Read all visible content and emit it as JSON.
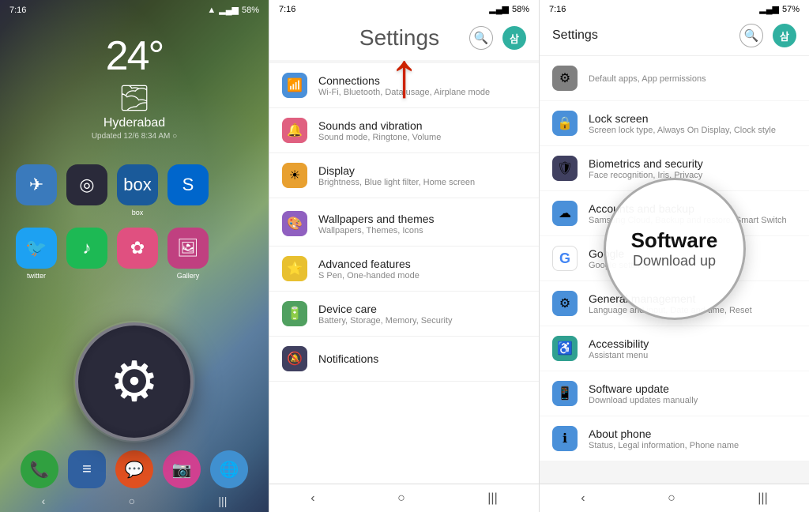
{
  "panel1": {
    "status": {
      "time": "7:16",
      "battery": "58%",
      "signal": "▂▄▆",
      "wifi": "WiFi"
    },
    "weather": {
      "temp": "24°",
      "city": "Hyderabad",
      "updated": "Updated 12/6 8:34 AM ○",
      "icon": "🌫"
    },
    "apps": [
      {
        "label": "",
        "icon": "✈",
        "color": "#3a7abc"
      },
      {
        "label": "",
        "icon": "◎",
        "color": "#2a2a3a"
      },
      {
        "label": "box",
        "icon": "📦",
        "color": "#1a5a9a"
      },
      {
        "label": "S",
        "icon": "S",
        "color": "#0066cc"
      },
      {
        "label": "twitter",
        "icon": "🐦",
        "color": "#1da1f2"
      },
      {
        "label": "",
        "icon": "🎵",
        "color": "#1db954"
      },
      {
        "label": "",
        "icon": "✿",
        "color": "#e05080"
      },
      {
        "label": "Gallery",
        "icon": "🖼",
        "color": "#c04080"
      }
    ],
    "dock": [
      {
        "icon": "📞",
        "color": "#30a040"
      },
      {
        "icon": "≡",
        "color": "#3060a0"
      },
      {
        "icon": "💬",
        "color": "#e05020"
      },
      {
        "icon": "📷",
        "color": "#d04090"
      },
      {
        "icon": "🌐",
        "color": "#4090d0"
      }
    ],
    "nav": [
      "‹",
      "○",
      "|||"
    ],
    "settings_label": "Settings"
  },
  "panel2": {
    "status": {
      "time": "7:16",
      "battery": "58%"
    },
    "title": "Settings",
    "arrow_label": "↑",
    "items": [
      {
        "icon": "📶",
        "color_class": "icon-blue",
        "title": "Connections",
        "sub": "Wi-Fi, Bluetooth, Data usage, Airplane mode"
      },
      {
        "icon": "🔔",
        "color_class": "icon-pink",
        "title": "Sounds and vibration",
        "sub": "Sound mode, Ringtone, Volume"
      },
      {
        "icon": "☀",
        "color_class": "icon-orange",
        "title": "Display",
        "sub": "Brightness, Blue light filter, Home screen"
      },
      {
        "icon": "🎨",
        "color_class": "icon-purple",
        "title": "Wallpapers and themes",
        "sub": "Wallpapers, Themes, Icons"
      },
      {
        "icon": "⭐",
        "color_class": "icon-yellow",
        "title": "Advanced features",
        "sub": "S Pen, One-handed mode"
      },
      {
        "icon": "🔋",
        "color_class": "icon-green",
        "title": "Device care",
        "sub": "Battery, Storage, Memory, Security"
      },
      {
        "icon": "🔕",
        "color_class": "icon-dark",
        "title": "Notifications",
        "sub": ""
      }
    ],
    "nav": [
      "‹",
      "○",
      "|||"
    ]
  },
  "panel3": {
    "status": {
      "time": "7:16",
      "battery": "57%"
    },
    "title": "Settings",
    "items": [
      {
        "icon": "⚙",
        "color_class": "icon-gray",
        "title": "Default apps, App permissions",
        "sub": ""
      },
      {
        "icon": "🔒",
        "color_class": "icon-blue",
        "title": "Lock screen",
        "sub": "Screen lock type, Always On Display, Clock style"
      },
      {
        "icon": "🛡",
        "color_class": "icon-dark",
        "title": "Biometrics and security",
        "sub": "Face recognition, Iris, Privacy"
      },
      {
        "icon": "☁",
        "color_class": "icon-blue",
        "title": "Accounts and backup",
        "sub": "Samsung Cloud, Backup and restore, Smart Switch"
      },
      {
        "icon": "G",
        "color_class": "icon-google",
        "title": "Google",
        "sub": "Google settings"
      },
      {
        "icon": "⚙",
        "color_class": "icon-blue",
        "title": "General management",
        "sub": "Language and input, Date and time, Reset"
      },
      {
        "icon": "♿",
        "color_class": "icon-teal",
        "title": "Accessibility",
        "sub": "Assistant menu"
      },
      {
        "icon": "📱",
        "color_class": "icon-blue",
        "title": "Software update",
        "sub": "Download updates manually"
      },
      {
        "icon": "ℹ",
        "color_class": "icon-blue",
        "title": "About phone",
        "sub": "Status, Legal information, Phone name"
      }
    ],
    "software_circle": {
      "title": "Software",
      "sub": "Download up"
    },
    "nav": [
      "‹",
      "○",
      "|||"
    ]
  }
}
